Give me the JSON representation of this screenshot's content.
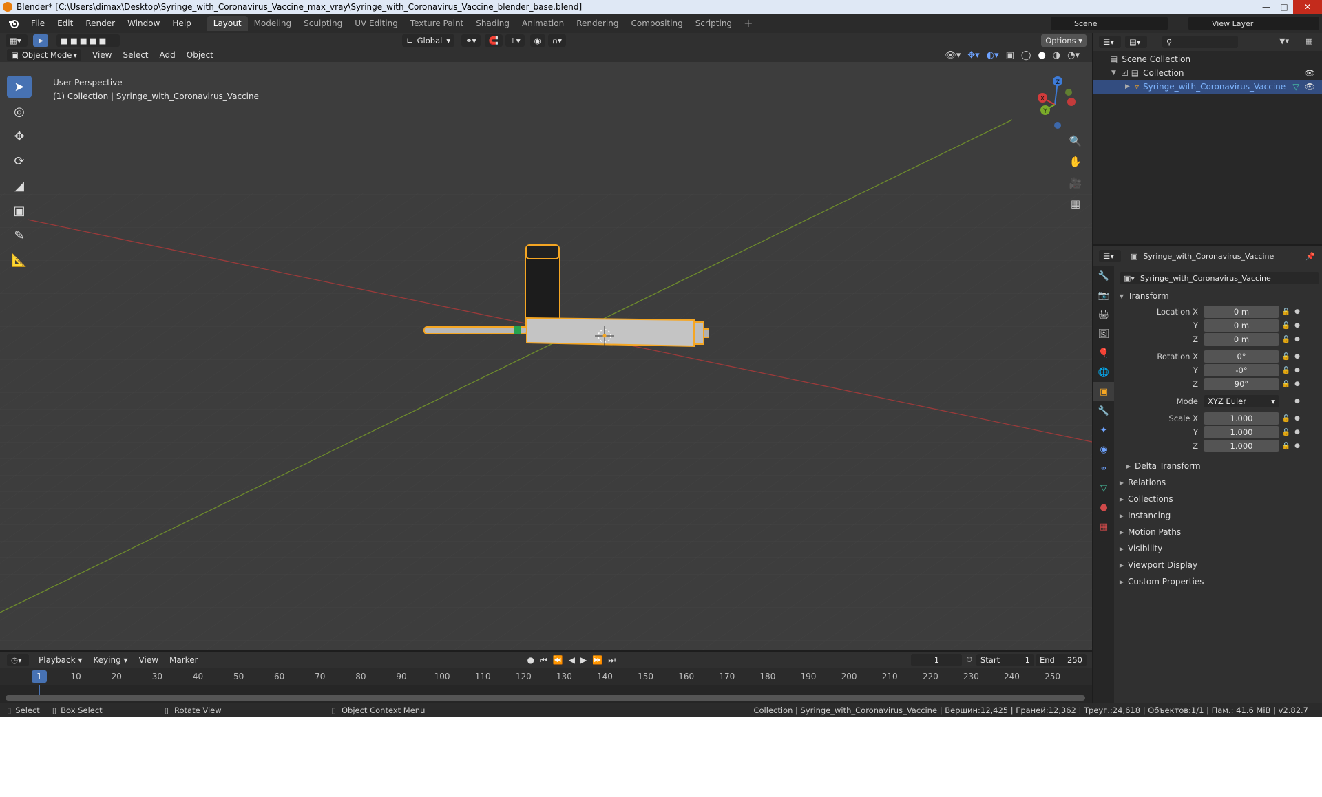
{
  "window": {
    "title": "Blender* [C:\\Users\\dimax\\Desktop\\Syringe_with_Coronavirus_Vaccine_max_vray\\Syringe_with_Coronavirus_Vaccine_blender_base.blend]"
  },
  "menu": [
    "File",
    "Edit",
    "Render",
    "Window",
    "Help"
  ],
  "workspaces": [
    "Layout",
    "Modeling",
    "Sculpting",
    "UV Editing",
    "Texture Paint",
    "Shading",
    "Animation",
    "Rendering",
    "Compositing",
    "Scripting"
  ],
  "active_workspace": "Layout",
  "scene": "Scene",
  "view_layer": "View Layer",
  "viewport": {
    "mode": "Object Mode",
    "menus": [
      "View",
      "Select",
      "Add",
      "Object"
    ],
    "orientation": "Global",
    "options": "Options",
    "perspective": "User Perspective",
    "collection_info": "(1) Collection | Syringe_with_Coronavirus_Vaccine",
    "gizmo": {
      "x": "X",
      "y": "Y",
      "z": "Z"
    }
  },
  "outliner": {
    "root": "Scene Collection",
    "collection": "Collection",
    "object": "Syringe_with_Coronavirus_Vaccine"
  },
  "properties": {
    "object_name": "Syringe_with_Coronavirus_Vaccine",
    "data_name": "Syringe_with_Coronavirus_Vaccine",
    "transform": {
      "title": "Transform",
      "location": {
        "label": "Location X",
        "x": "0 m",
        "y": "0 m",
        "z": "0 m"
      },
      "rotation": {
        "label": "Rotation X",
        "x": "0°",
        "y": "-0°",
        "z": "90°"
      },
      "mode_label": "Mode",
      "mode": "XYZ Euler",
      "scale": {
        "label": "Scale X",
        "x": "1.000",
        "y": "1.000",
        "z": "1.000"
      },
      "axis_y": "Y",
      "axis_z": "Z",
      "delta": "Delta Transform"
    },
    "sections": [
      "Relations",
      "Collections",
      "Instancing",
      "Motion Paths",
      "Visibility",
      "Viewport Display",
      "Custom Properties"
    ]
  },
  "timeline": {
    "menus": [
      "Playback",
      "Keying",
      "View",
      "Marker"
    ],
    "current_frame": "1",
    "start_label": "Start",
    "start": "1",
    "end_label": "End",
    "end": "250",
    "ticks": [
      "1",
      "10",
      "20",
      "30",
      "40",
      "50",
      "60",
      "70",
      "80",
      "90",
      "100",
      "110",
      "120",
      "130",
      "140",
      "150",
      "160",
      "170",
      "180",
      "190",
      "200",
      "210",
      "220",
      "230",
      "240",
      "250"
    ]
  },
  "statusbar": {
    "select": "Select",
    "box_select": "Box Select",
    "rotate": "Rotate View",
    "context": "Object Context Menu",
    "stats": "Collection | Syringe_with_Coronavirus_Vaccine | Вершин:12,425 | Граней:12,362 | Треуг.:24,618 | Объектов:1/1 | Пам.: 41.6 MiB | v2.82.7"
  },
  "colors": {
    "accent": "#4772b3",
    "selection": "#f5a623",
    "x_axis": "#d23b3b",
    "y_axis": "#7aab2a",
    "z_axis": "#3d7bd8"
  }
}
